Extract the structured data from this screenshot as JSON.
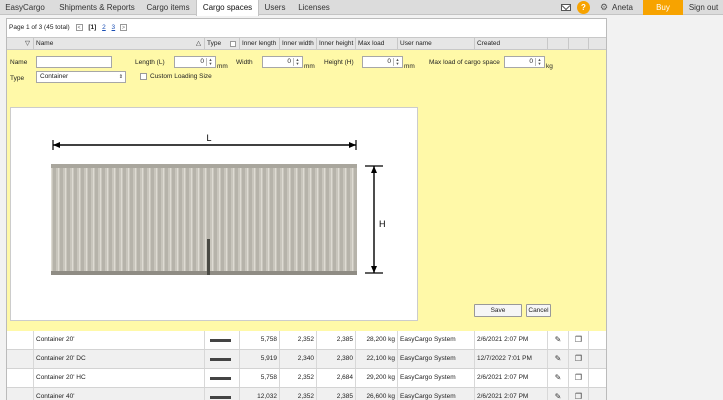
{
  "nav": {
    "tabs": [
      "EasyCargo",
      "Shipments & Reports",
      "Cargo items",
      "Cargo spaces",
      "Users",
      "Licenses"
    ],
    "active_tab": "Cargo spaces",
    "user": "Aneta",
    "buy": "Buy",
    "signout": "Sign out",
    "help": "?"
  },
  "pager": {
    "text": "Page 1 of 3 (45 total)",
    "prev": "<",
    "current": "[1]",
    "page2": "2",
    "page3": "3",
    "next": ">"
  },
  "columns": [
    "Name",
    "Type",
    "Inner length",
    "Inner width",
    "Inner height",
    "Max load",
    "User name",
    "Created"
  ],
  "filter_icon": "▽",
  "sort_icon": "△",
  "form": {
    "name_label": "Name",
    "name_value": "",
    "length_label": "Length (L)",
    "length_value": "0",
    "width_label": "Width",
    "width_value": "0",
    "height_label": "Height (H)",
    "height_value": "0",
    "maxload_label": "Max load of cargo space",
    "maxload_value": "0",
    "unit_mm": "mm",
    "unit_kg": "kg",
    "type_label": "Type",
    "type_value": "Container",
    "custom_label": "Custom Loading Size",
    "dim_l": "L",
    "dim_h": "H",
    "save": "Save",
    "cancel": "Cancel"
  },
  "rows": [
    {
      "name": "Container 20'",
      "length": "5,758",
      "width": "2,352",
      "height": "2,385",
      "maxload": "28,200 kg",
      "user": "EasyCargo System",
      "created": "2/6/2021 2:07 PM"
    },
    {
      "name": "Container 20' DC",
      "length": "5,919",
      "width": "2,340",
      "height": "2,380",
      "maxload": "22,100 kg",
      "user": "EasyCargo System",
      "created": "12/7/2022 7:01 PM"
    },
    {
      "name": "Container 20' HC",
      "length": "5,758",
      "width": "2,352",
      "height": "2,684",
      "maxload": "29,200 kg",
      "user": "EasyCargo System",
      "created": "2/6/2021 2:07 PM"
    },
    {
      "name": "Container 40'",
      "length": "12,032",
      "width": "2,352",
      "height": "2,385",
      "maxload": "26,600 kg",
      "user": "EasyCargo System",
      "created": "2/6/2021 2:07 PM"
    }
  ]
}
